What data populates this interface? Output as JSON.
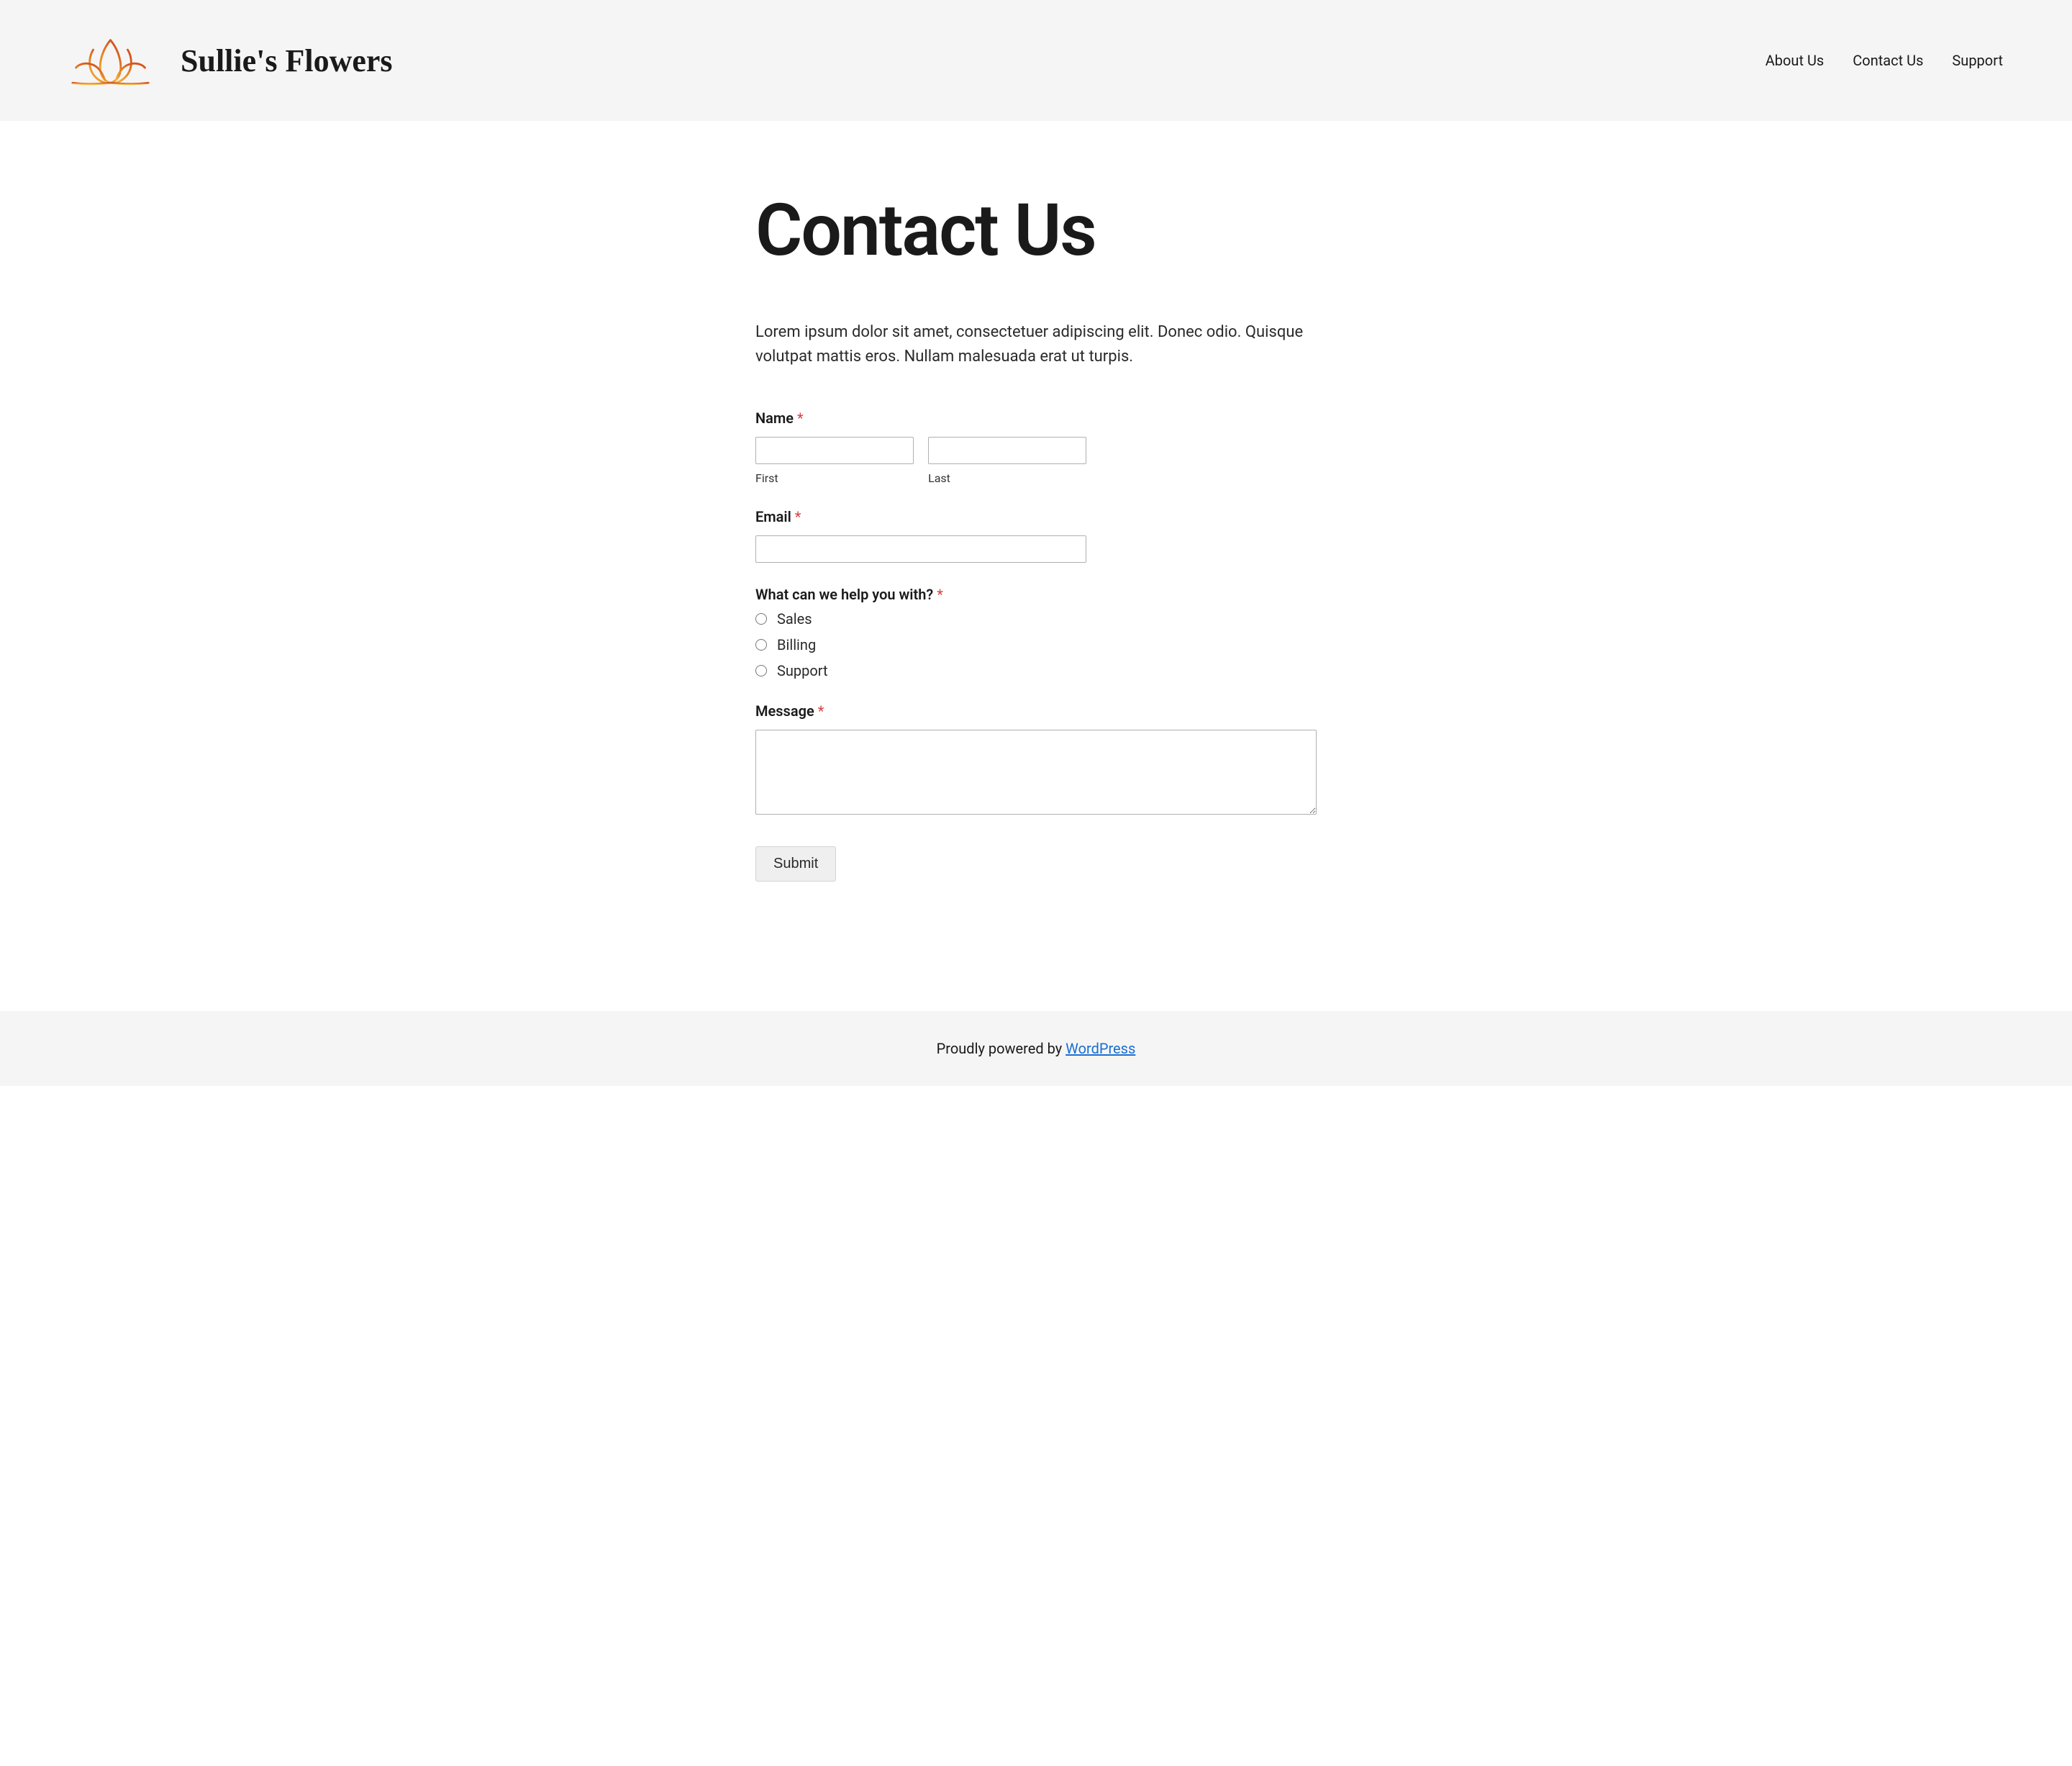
{
  "header": {
    "brand_name": "Sullie's Flowers",
    "nav": [
      {
        "label": "About Us"
      },
      {
        "label": "Contact Us"
      },
      {
        "label": "Support"
      }
    ]
  },
  "page": {
    "title": "Contact Us",
    "intro": "Lorem ipsum dolor sit amet, consectetuer adipiscing elit. Donec odio. Quisque volutpat mattis eros. Nullam malesuada erat ut turpis."
  },
  "form": {
    "name": {
      "label": "Name",
      "first_sublabel": "First",
      "last_sublabel": "Last"
    },
    "email": {
      "label": "Email"
    },
    "topic": {
      "label": "What can we help you with?",
      "options": [
        "Sales",
        "Billing",
        "Support"
      ]
    },
    "message": {
      "label": "Message"
    },
    "submit_label": "Submit",
    "required_marker": "*"
  },
  "footer": {
    "prefix": "Proudly powered by ",
    "link_text": "WordPress"
  }
}
